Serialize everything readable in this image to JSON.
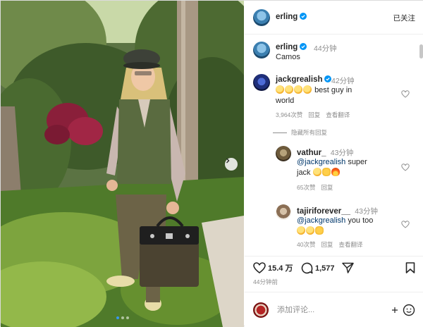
{
  "post": {
    "author": "erling",
    "follow_status": "已关注",
    "caption_author": "erling",
    "caption_time": "44分钟",
    "caption_text": "Camos",
    "likes": "15.4 万",
    "comment_count": "1,577",
    "posted_ago": "44分钟前"
  },
  "comments": [
    {
      "user": "jackgrealish",
      "time": "42分钟",
      "text_line1": "best guy in",
      "text_line2": "world",
      "likes": "3,964次赞",
      "reply": "回复",
      "view_translation": "查看翻译"
    }
  ],
  "hide_replies": "隐藏所有回复",
  "replies": [
    {
      "user": "vathur_",
      "time": "43分钟",
      "mention": "@jackgrealish",
      "text_line1": "super",
      "text_line2": "jack",
      "likes": "65次赞",
      "reply": "回复"
    },
    {
      "user": "tajiriforever__",
      "time": "43分钟",
      "mention": "@jackgrealish",
      "text_line1": "you too",
      "likes": "40次赞",
      "reply": "回复",
      "view_translation": "查看翻译"
    }
  ],
  "comment_box": {
    "placeholder": "添加评论..."
  },
  "colors": {
    "verified": "#0095f6",
    "mention": "#00376b",
    "muted": "#8e8e8e"
  },
  "icons": [
    "heart-icon",
    "comment-icon",
    "share-icon",
    "bookmark-icon",
    "emoji-icon",
    "verified-icon",
    "chevron-right-icon"
  ]
}
